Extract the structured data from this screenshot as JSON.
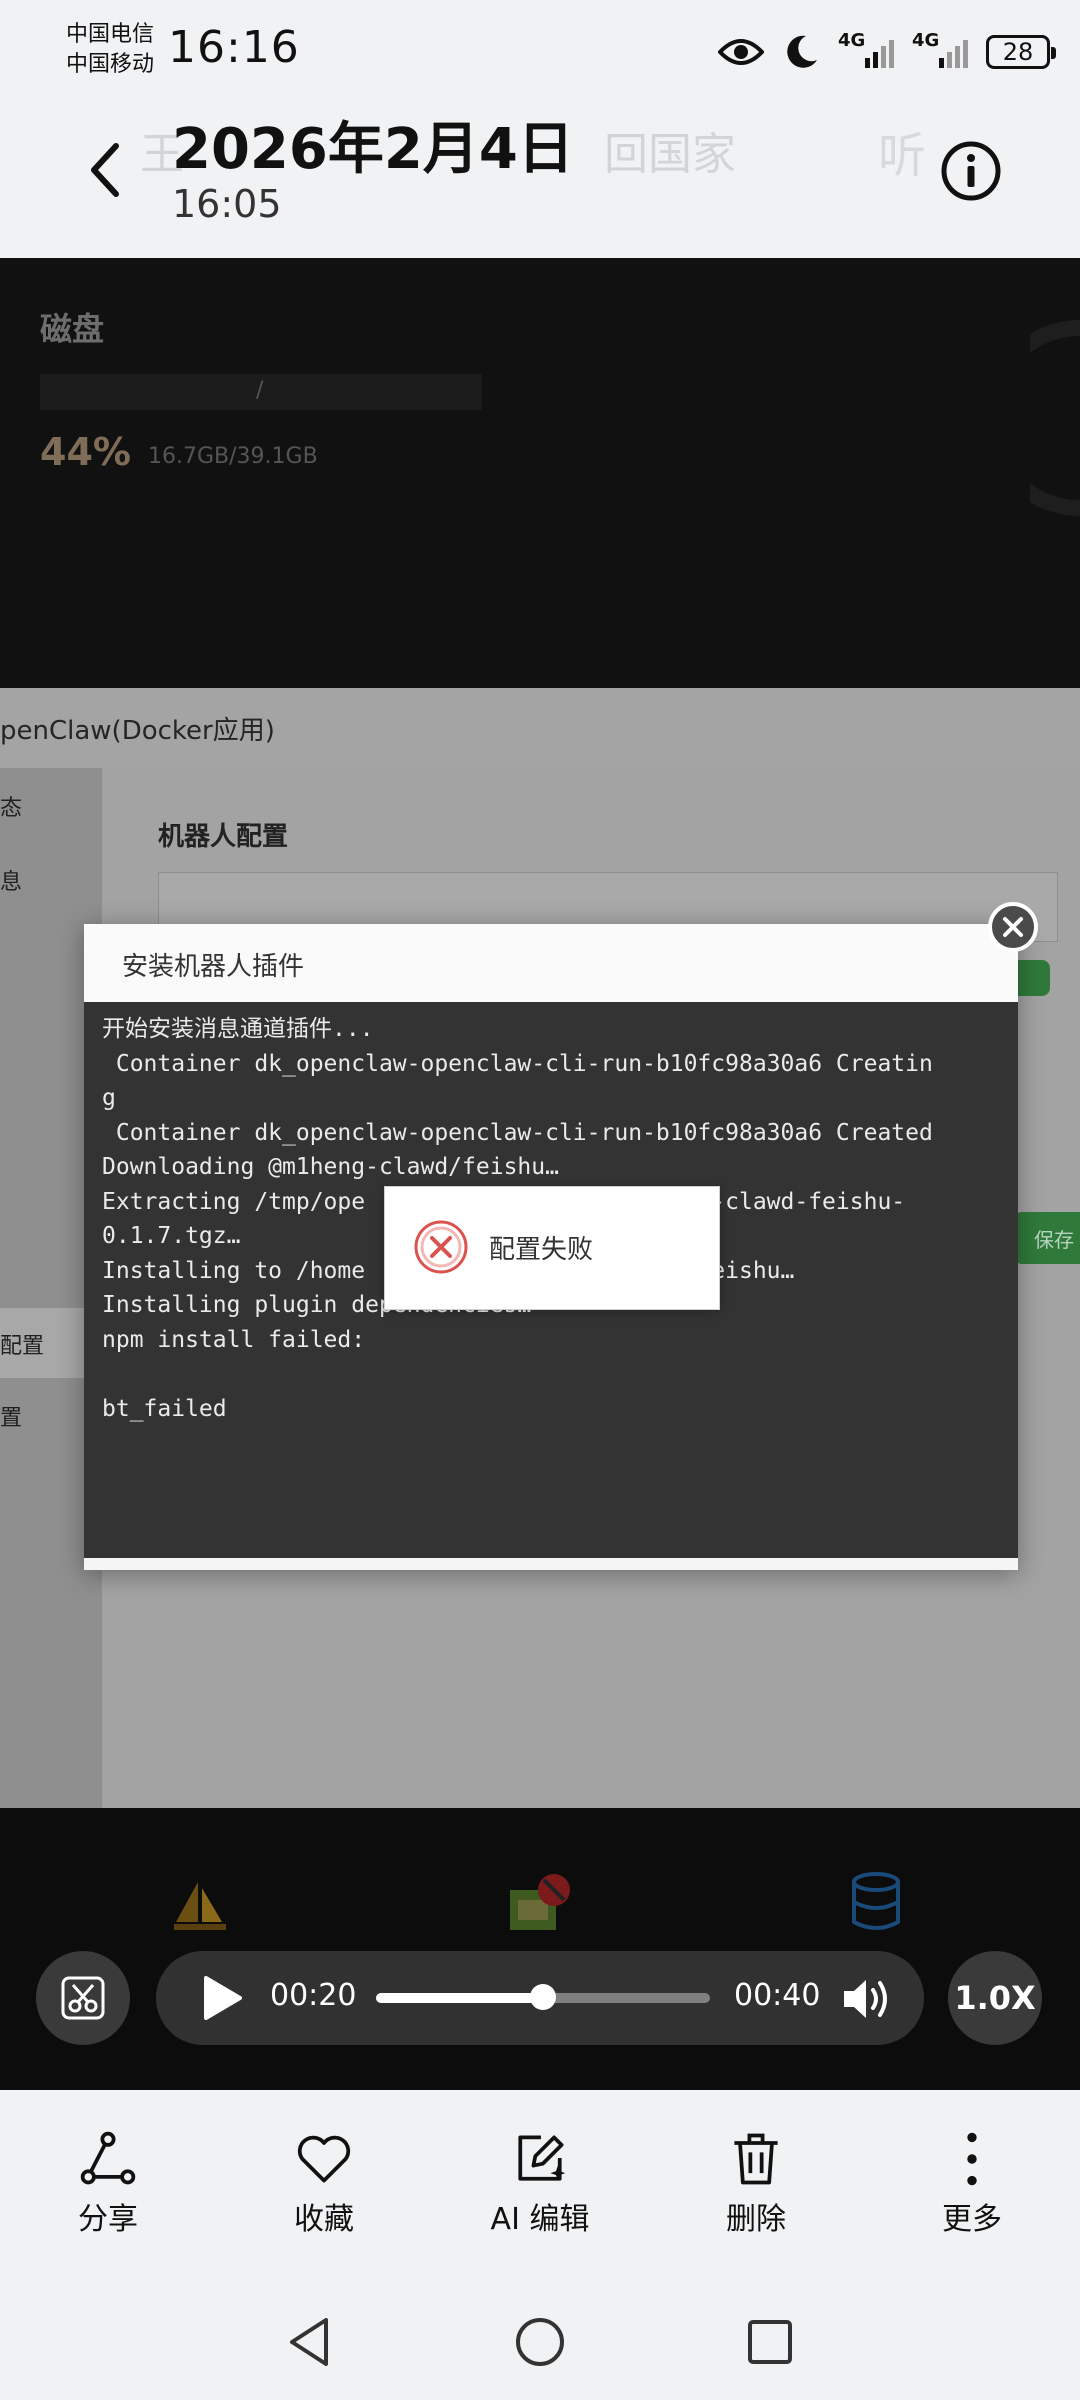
{
  "status_bar": {
    "carrier_1": "中国电信",
    "carrier_2": "中国移动",
    "time": "16:16",
    "signal_1": "4G",
    "signal_2": "4G",
    "battery": "28"
  },
  "header": {
    "date": "2026年2月4日",
    "time": "16:05"
  },
  "screenshot": {
    "disk_title": "磁盘",
    "disk_bar_label": "/",
    "disk_percent": "44%",
    "disk_usage": "16.7GB/39.1GB",
    "app_title": "penClaw(Docker应用)",
    "sidebar_items": [
      "态",
      "息",
      "配置",
      "置"
    ],
    "section_title": "机器人配置",
    "save_label": "保存",
    "dialog": {
      "title": "安装机器人插件",
      "console_lines": [
        "开始安装消息通道插件...",
        " Container dk_openclaw-openclaw-cli-run-b10fc98a30a6 Creatin",
        "g",
        " Container dk_openclaw-openclaw-cli-run-b10fc98a30a6 Created",
        "Downloading @m1heng-clawd/feishu…",
        "Extracting /tmp/ope                    1heng-clawd-feishu-",
        "0.1.7.tgz…",
        "Installing to /home                    ons/feishu…",
        "Installing plugin dependencies…",
        "npm install failed:",
        "",
        "bt_failed"
      ]
    },
    "toast": "配置失败"
  },
  "player": {
    "current_time": "00:20",
    "total_time": "00:40",
    "progress": 0.5,
    "speed": "1.0X"
  },
  "toolbar": {
    "share": "分享",
    "favorite": "收藏",
    "ai_edit": "AI 编辑",
    "delete": "删除",
    "more": "更多"
  },
  "ghost_header": {
    "title": "王",
    "extra": "回国家",
    "listen": "听"
  }
}
